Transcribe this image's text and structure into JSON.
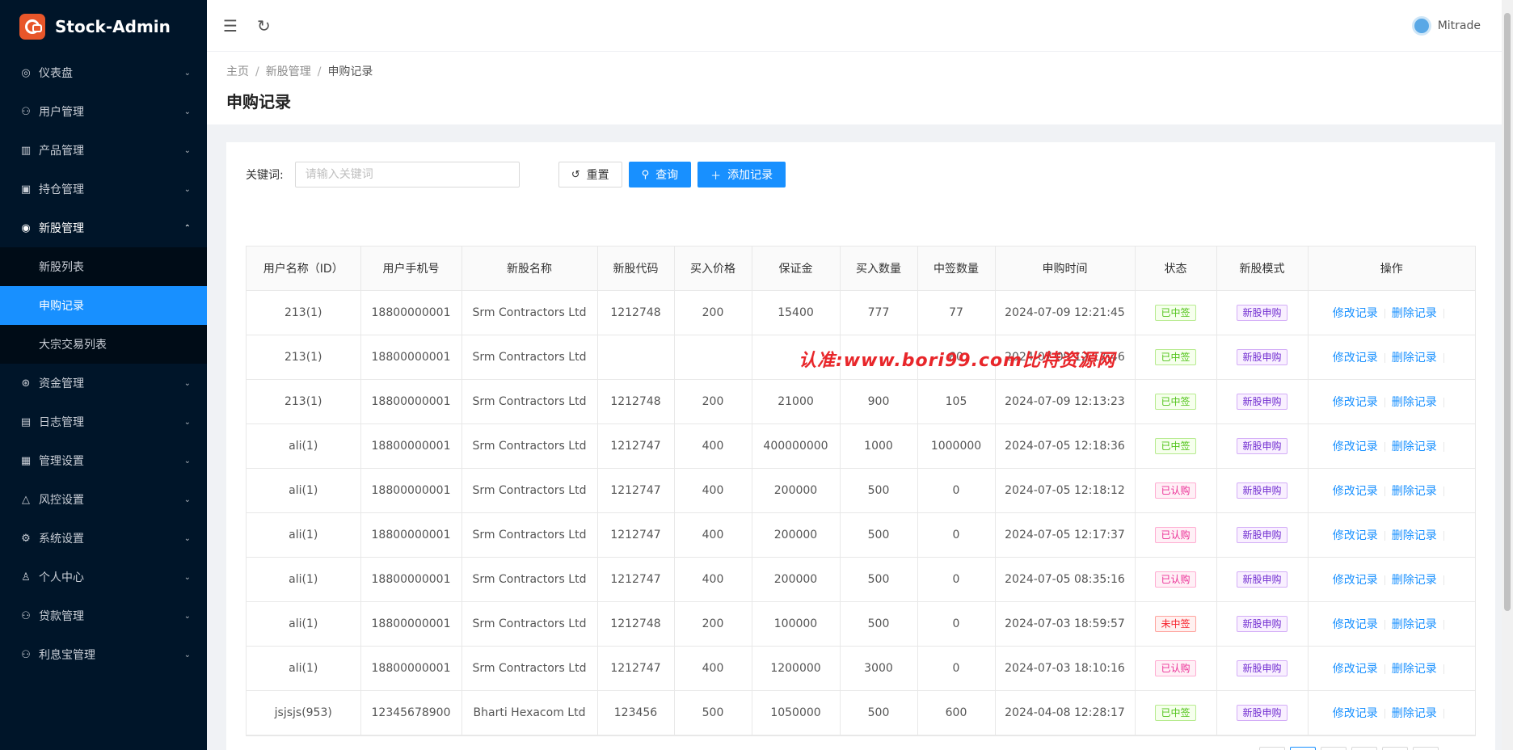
{
  "brand": {
    "title": "Stock-Admin"
  },
  "sidebar": {
    "items_top": [
      {
        "label": "仪表盘",
        "icon": "dashboard-icon",
        "glyph": "◎"
      },
      {
        "label": "用户管理",
        "icon": "users-icon",
        "glyph": "⚇"
      },
      {
        "label": "产品管理",
        "icon": "chart-icon",
        "glyph": "▥"
      },
      {
        "label": "持仓管理",
        "icon": "position-icon",
        "glyph": "▣"
      }
    ],
    "open_item": {
      "label": "新股管理",
      "icon": "ipo-icon",
      "glyph": "◉"
    },
    "sub_items": [
      "新股列表",
      "申购记录",
      "大宗交易列表"
    ],
    "active_sub": 1,
    "items_bottom": [
      {
        "label": "资金管理",
        "icon": "money-icon",
        "glyph": "⊛"
      },
      {
        "label": "日志管理",
        "icon": "log-icon",
        "glyph": "▤"
      },
      {
        "label": "管理设置",
        "icon": "admin-settings-icon",
        "glyph": "▦"
      },
      {
        "label": "风控设置",
        "icon": "warning-icon",
        "glyph": "△"
      },
      {
        "label": "系统设置",
        "icon": "gear-icon",
        "glyph": "⚙"
      },
      {
        "label": "个人中心",
        "icon": "user-icon",
        "glyph": "♙"
      },
      {
        "label": "贷款管理",
        "icon": "loan-icon",
        "glyph": "⚇"
      },
      {
        "label": "利息宝管理",
        "icon": "interest-icon",
        "glyph": "⚇"
      }
    ]
  },
  "header": {
    "user_name": "Mitrade"
  },
  "breadcrumb": {
    "home": "主页",
    "section": "新股管理",
    "current": "申购记录"
  },
  "page_title": "申购记录",
  "search": {
    "label": "关键词:",
    "placeholder": "请输入关键词",
    "value": "",
    "reset_label": "重置",
    "query_label": "查询",
    "add_label": "添加记录"
  },
  "table": {
    "columns": [
      "用户名称（ID）",
      "用户手机号",
      "新股名称",
      "新股代码",
      "买入价格",
      "保证金",
      "买入数量",
      "中签数量",
      "申购时间",
      "状态",
      "新股模式",
      "操作"
    ],
    "edit_label": "修改记录",
    "delete_label": "删除记录",
    "rows": [
      {
        "user": "213(1)",
        "phone": "18800000001",
        "name": "Srm Contractors Ltd",
        "code": "1212748",
        "price": "200",
        "deposit": "15400",
        "qty": "777",
        "won": "77",
        "time": "2024-07-09 12:21:45",
        "status": "已中签",
        "status_type": "green",
        "mode": "新股申购"
      },
      {
        "user": "213(1)",
        "phone": "18800000001",
        "name": "Srm Contractors Ltd",
        "code": "",
        "price": "",
        "deposit": "",
        "qty": "",
        "won": "80",
        "time": "2024-07-09 12:17:46",
        "status": "已中签",
        "status_type": "green",
        "mode": "新股申购"
      },
      {
        "user": "213(1)",
        "phone": "18800000001",
        "name": "Srm Contractors Ltd",
        "code": "1212748",
        "price": "200",
        "deposit": "21000",
        "qty": "900",
        "won": "105",
        "time": "2024-07-09 12:13:23",
        "status": "已中签",
        "status_type": "green",
        "mode": "新股申购"
      },
      {
        "user": "ali(1)",
        "phone": "18800000001",
        "name": "Srm Contractors Ltd",
        "code": "1212747",
        "price": "400",
        "deposit": "400000000",
        "qty": "1000",
        "won": "1000000",
        "time": "2024-07-05 12:18:36",
        "status": "已中签",
        "status_type": "green",
        "mode": "新股申购"
      },
      {
        "user": "ali(1)",
        "phone": "18800000001",
        "name": "Srm Contractors Ltd",
        "code": "1212747",
        "price": "400",
        "deposit": "200000",
        "qty": "500",
        "won": "0",
        "time": "2024-07-05 12:18:12",
        "status": "已认购",
        "status_type": "magenta",
        "mode": "新股申购"
      },
      {
        "user": "ali(1)",
        "phone": "18800000001",
        "name": "Srm Contractors Ltd",
        "code": "1212747",
        "price": "400",
        "deposit": "200000",
        "qty": "500",
        "won": "0",
        "time": "2024-07-05 12:17:37",
        "status": "已认购",
        "status_type": "magenta",
        "mode": "新股申购"
      },
      {
        "user": "ali(1)",
        "phone": "18800000001",
        "name": "Srm Contractors Ltd",
        "code": "1212747",
        "price": "400",
        "deposit": "200000",
        "qty": "500",
        "won": "0",
        "time": "2024-07-05 08:35:16",
        "status": "已认购",
        "status_type": "magenta",
        "mode": "新股申购"
      },
      {
        "user": "ali(1)",
        "phone": "18800000001",
        "name": "Srm Contractors Ltd",
        "code": "1212748",
        "price": "200",
        "deposit": "100000",
        "qty": "500",
        "won": "0",
        "time": "2024-07-03 18:59:57",
        "status": "未中签",
        "status_type": "red",
        "mode": "新股申购"
      },
      {
        "user": "ali(1)",
        "phone": "18800000001",
        "name": "Srm Contractors Ltd",
        "code": "1212747",
        "price": "400",
        "deposit": "1200000",
        "qty": "3000",
        "won": "0",
        "time": "2024-07-03 18:10:16",
        "status": "已认购",
        "status_type": "magenta",
        "mode": "新股申购"
      },
      {
        "user": "jsjsjs(953)",
        "phone": "12345678900",
        "name": "Bharti Hexacom Ltd",
        "code": "123456",
        "price": "500",
        "deposit": "1050000",
        "qty": "500",
        "won": "600",
        "time": "2024-04-08 12:28:17",
        "status": "已中签",
        "status_type": "green",
        "mode": "新股申购"
      }
    ]
  },
  "watermark": "认准:www.bori99.com比特资源网",
  "colors": {
    "sidebar_bg": "#001529",
    "accent": "#1890ff"
  }
}
